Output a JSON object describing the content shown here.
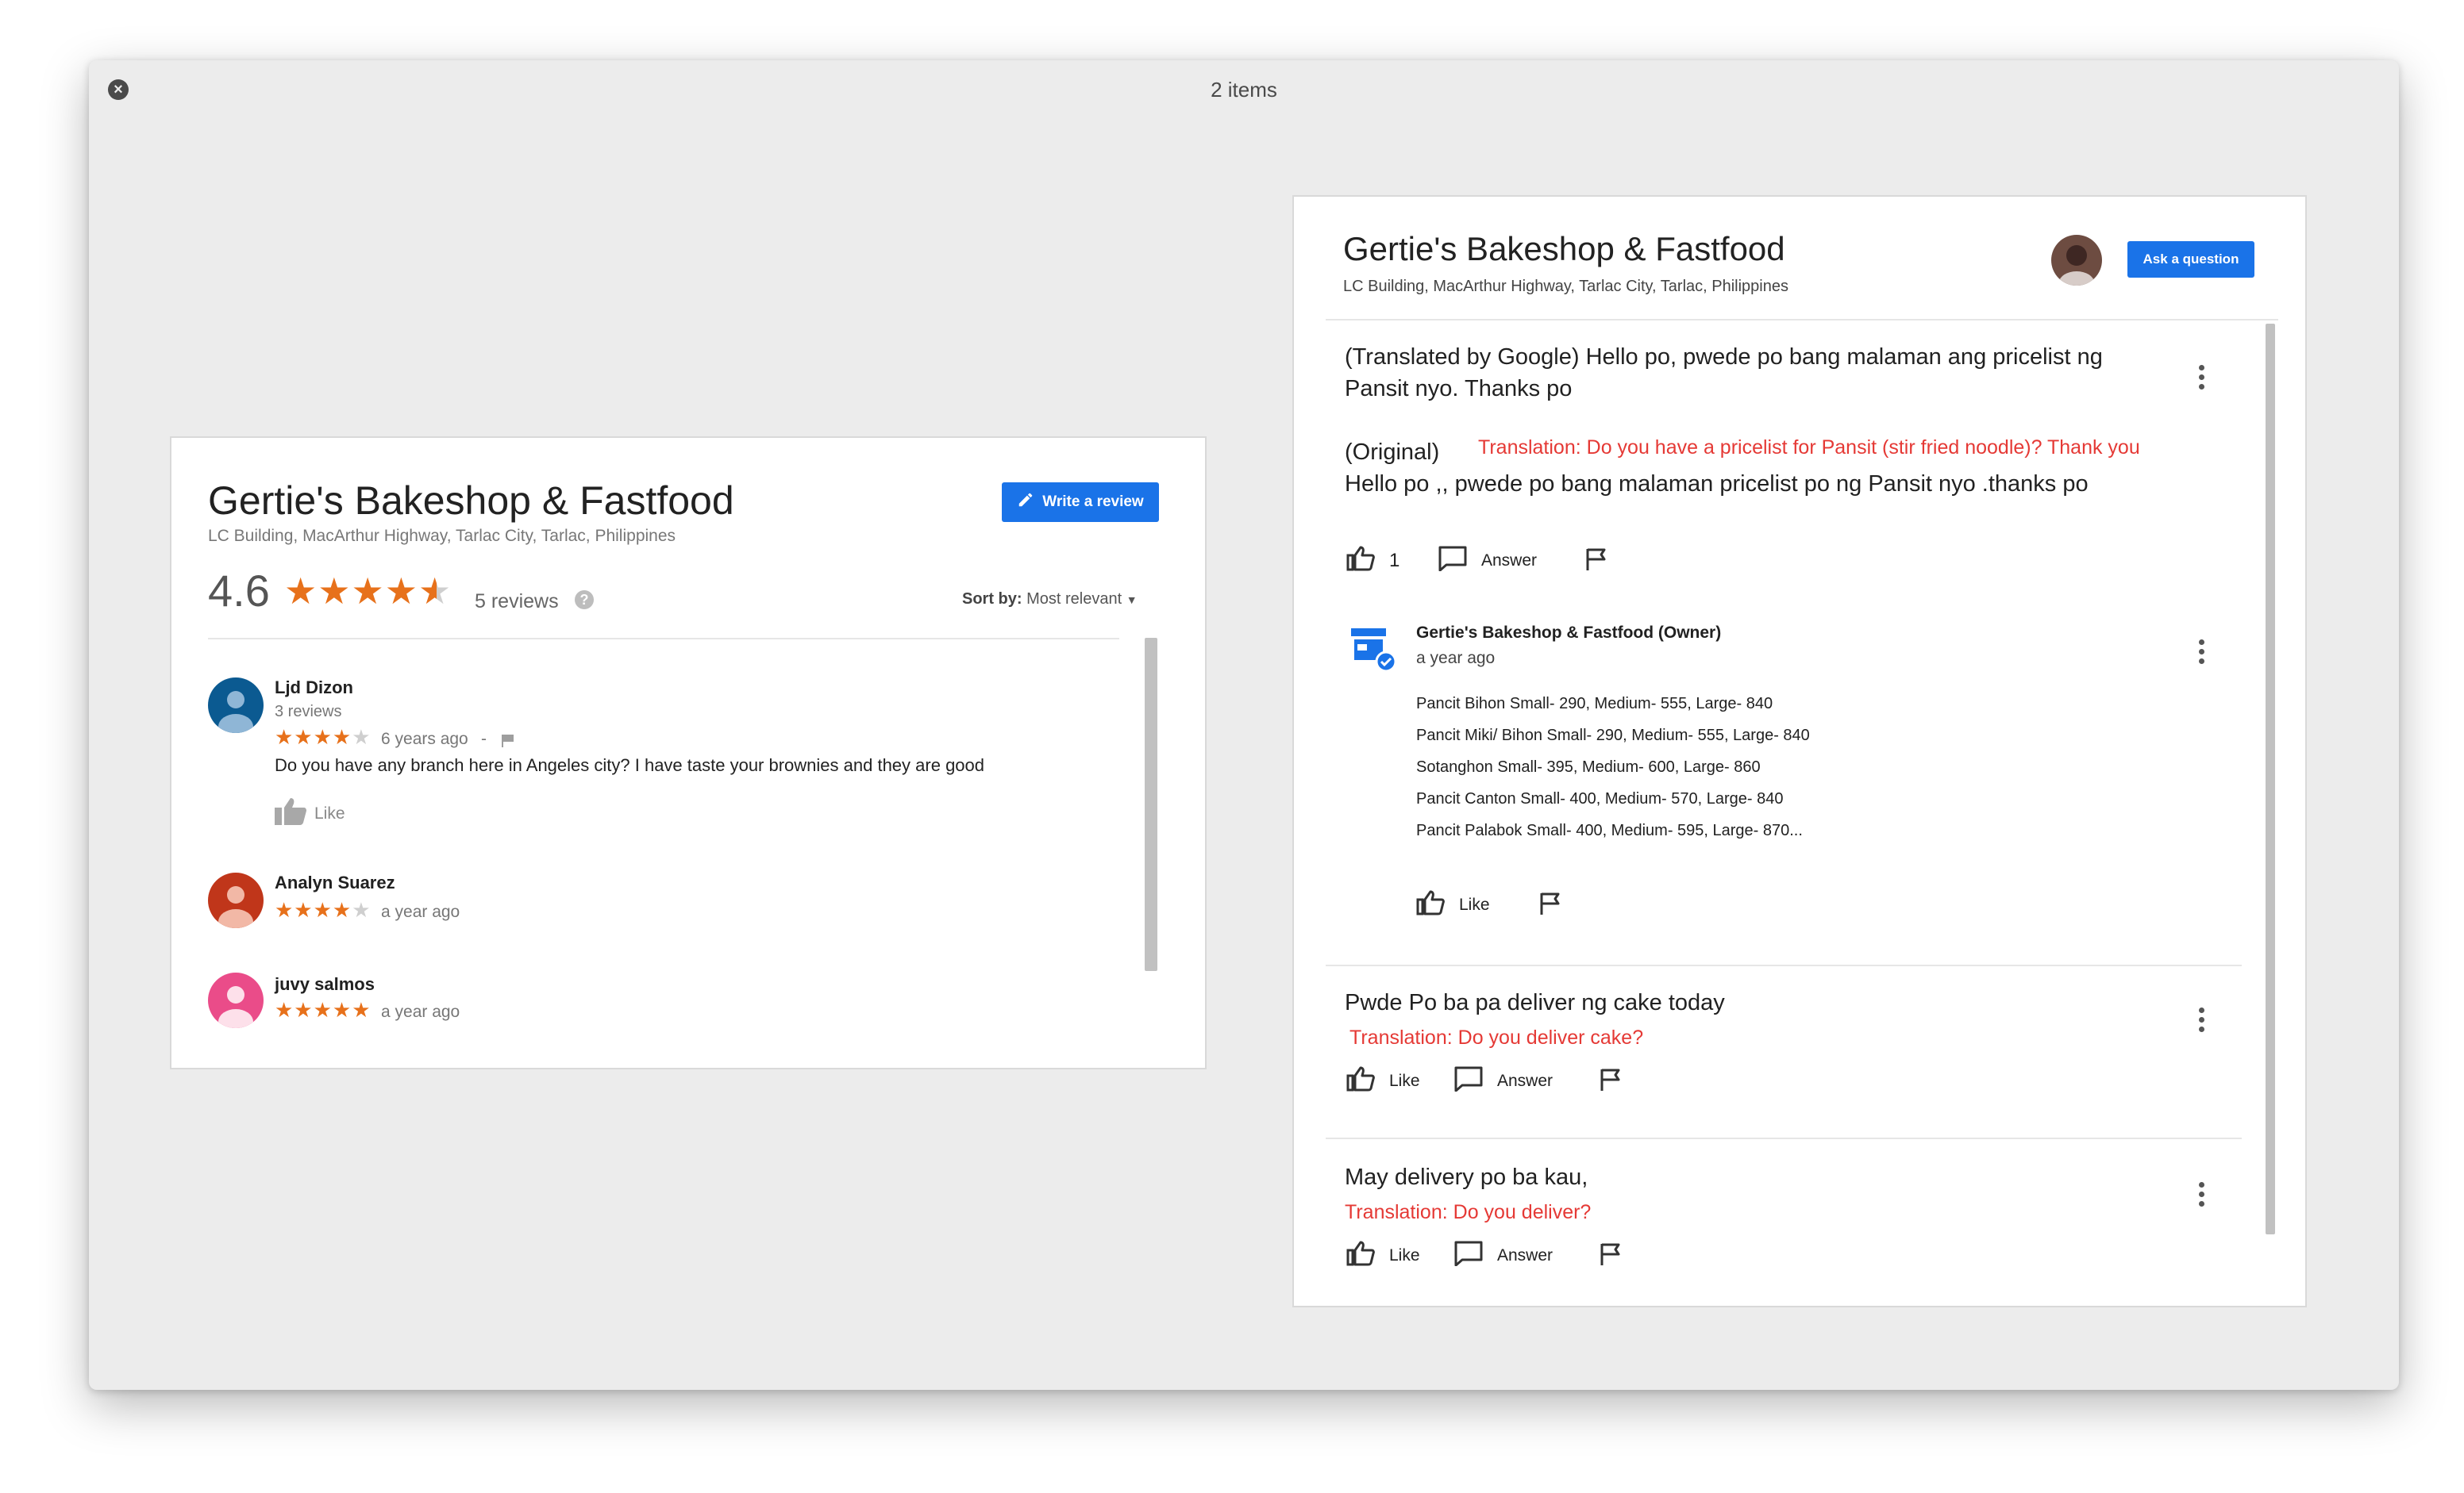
{
  "window": {
    "title": "2 items"
  },
  "left_card": {
    "business_name": "Gertie's Bakeshop & Fastfood",
    "address": "LC Building, MacArthur Highway, Tarlac City, Tarlac, Philippines",
    "rating_value": "4.6",
    "rating_stars": 4.5,
    "review_count": "5 reviews",
    "write_review_label": "Write a review",
    "sort_label": "Sort by:",
    "sort_value": "Most relevant",
    "reviews": [
      {
        "name": "Ljd Dizon",
        "meta": "3 reviews",
        "stars": 4,
        "time": "6 years ago",
        "separator": "-",
        "text": "Do you have any branch here in Angeles city? I have taste your brownies and they are good",
        "like_label": "Like",
        "avatar_color": "#0b5a91"
      },
      {
        "name": "Analyn Suarez",
        "stars": 4,
        "time": "a year ago",
        "avatar_color": "#c0361a"
      },
      {
        "name": "juvy salmos",
        "stars": 5,
        "time": "a year ago",
        "avatar_color": "#ea4c89"
      }
    ]
  },
  "right_card": {
    "business_name": "Gertie's Bakeshop & Fastfood",
    "address": "LC Building, MacArthur Highway, Tarlac City, Tarlac, Philippines",
    "ask_label": "Ask a question",
    "questions": [
      {
        "translated_line1": "(Translated by Google) Hello po, pwede po bang malaman ang pricelist ng",
        "translated_line2": "Pansit nyo. Thanks po",
        "original_label": "(Original)",
        "annotation": "Translation: Do you have a pricelist for Pansit (stir fried noodle)? Thank you",
        "original_text": "Hello po ,, pwede po bang malaman pricelist po ng Pansit nyo .thanks po",
        "like_count": "1",
        "answer_label": "Answer",
        "owner_answer": {
          "name": "Gertie's Bakeshop & Fastfood (Owner)",
          "time": "a year ago",
          "lines": [
            "Pancit Bihon Small- 290, Medium- 555, Large- 840",
            "Pancit Miki/ Bihon Small- 290, Medium- 555, Large- 840",
            "Sotanghon Small- 395, Medium- 600, Large- 860",
            "Pancit Canton Small- 400, Medium- 570, Large- 840",
            "Pancit Palabok Small- 400, Medium- 595, Large- 870..."
          ],
          "like_label": "Like"
        }
      },
      {
        "text": "Pwde Po ba pa deliver ng cake today",
        "annotation": "Translation: Do you deliver cake?",
        "like_label": "Like",
        "answer_label": "Answer"
      },
      {
        "text": "May delivery po ba kau,",
        "annotation": "Translation: Do you deliver?",
        "like_label": "Like",
        "answer_label": "Answer"
      }
    ]
  },
  "colors": {
    "accent_blue": "#1a73e8",
    "star_orange": "#e7711b",
    "annotation_red": "#e53935"
  }
}
